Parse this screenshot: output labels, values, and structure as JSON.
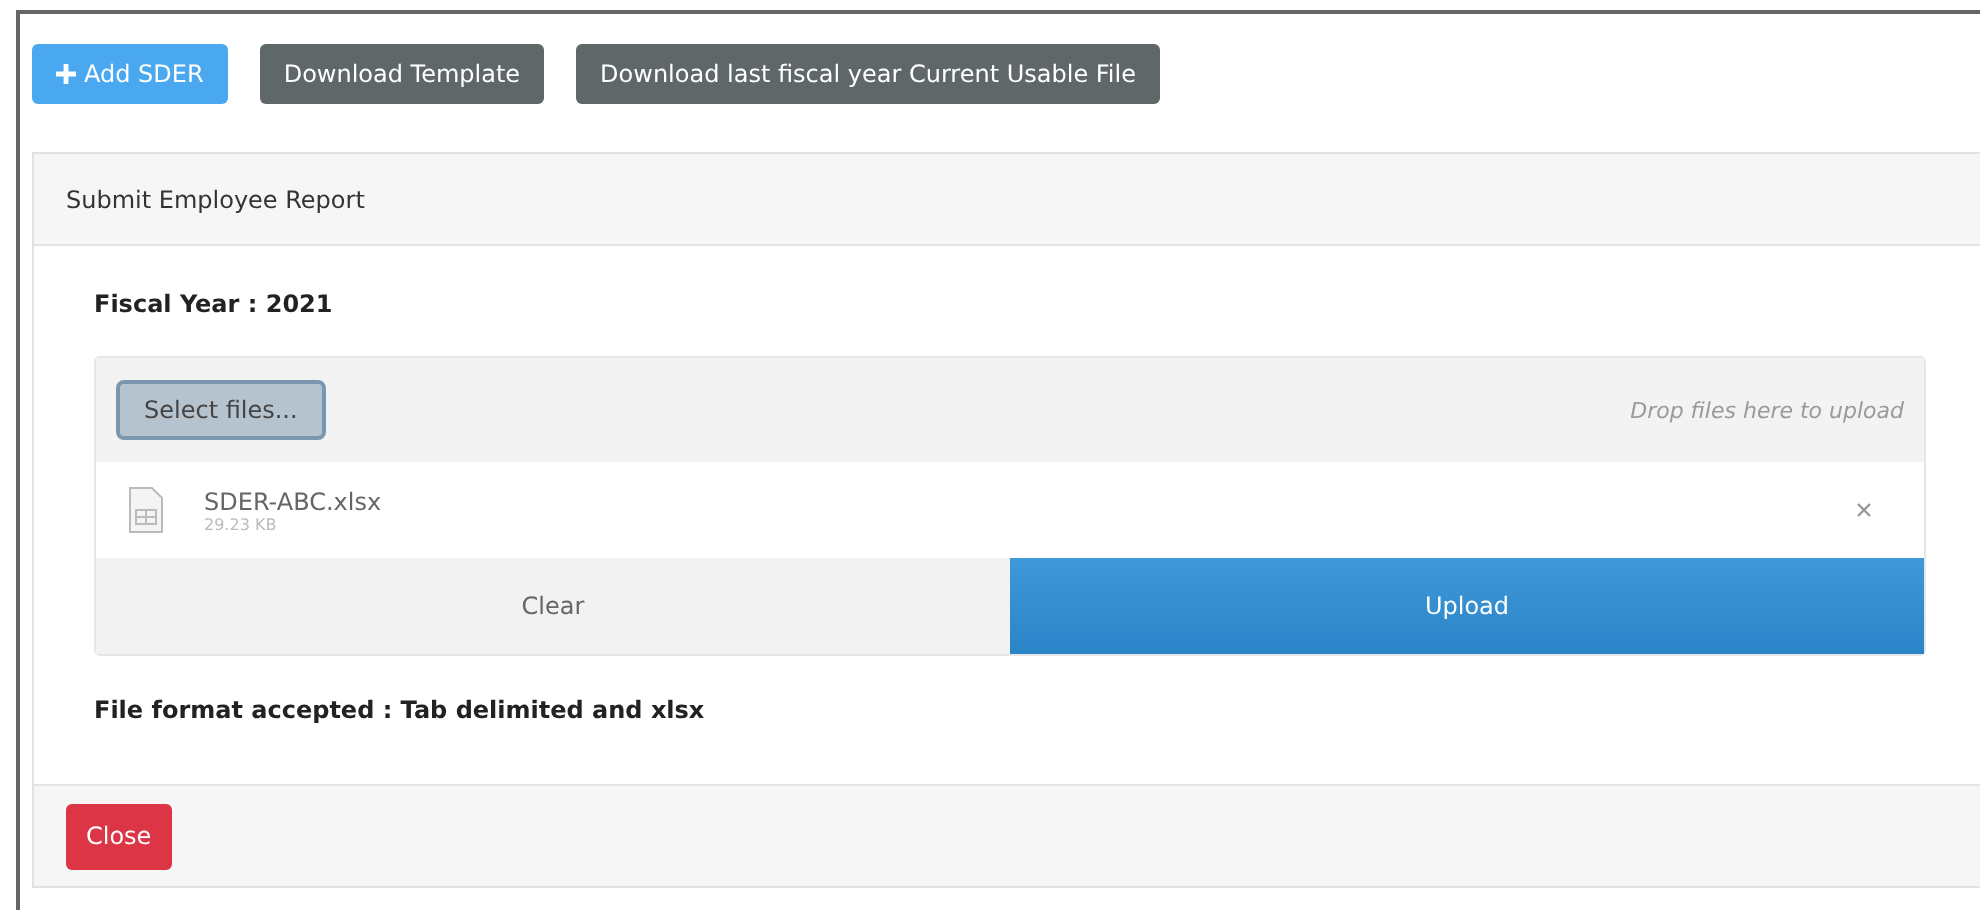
{
  "toolbar": [
    {
      "label": "Add SDER",
      "kind": "add"
    },
    {
      "label": "Download Template",
      "kind": "secondary"
    },
    {
      "label": "Download last fiscal year Current Usable File",
      "kind": "secondary"
    }
  ],
  "panel": {
    "title": "Submit Employee Report",
    "fiscal_year": "Fiscal Year : 2021",
    "upload": {
      "select_button": "Select files...",
      "drop_hint": "Drop files here to upload",
      "files": [
        {
          "name": "SDER-ABC.xlsx",
          "size": "29.23 KB"
        }
      ],
      "clear_button": "Clear",
      "upload_button": "Upload"
    },
    "format_note": "File format accepted : Tab delimited and xlsx"
  },
  "footer": {
    "close_button": "Close"
  }
}
